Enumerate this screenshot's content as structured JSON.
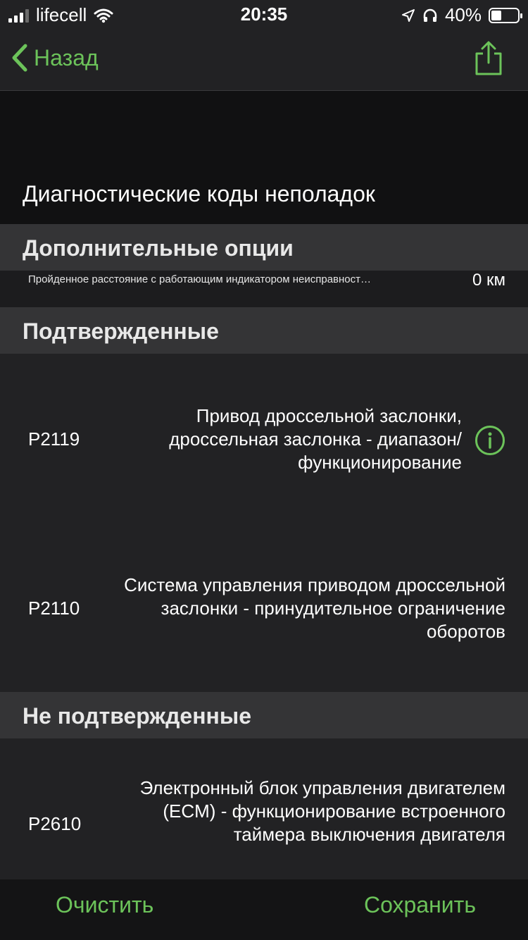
{
  "status_bar": {
    "carrier": "lifecell",
    "time": "20:35",
    "battery": "40%",
    "battery_level": 0.4
  },
  "nav": {
    "back_label": "Назад",
    "back_icon": "chevron-left-icon",
    "share_icon": "share-icon"
  },
  "page": {
    "title": "Диагностические коды неполадок"
  },
  "sections": {
    "options": {
      "title": "Дополнительные опции",
      "rows": [
        {
          "label": "Пройденное расстояние с работающим индикатором неисправност…",
          "value": "0 км"
        }
      ]
    },
    "confirmed": {
      "title": "Подтвержденные",
      "rows": [
        {
          "code": "P2119",
          "description": "Привод дроссельной заслонки, дроссельная заслонка - диапазон/ функционирование"
        },
        {
          "code": "P2110",
          "description": "Система управления приводом дроссельной заслонки - принудительное ограничение оборотов"
        }
      ]
    },
    "unconfirmed": {
      "title": "Не подтвержденные",
      "rows": [
        {
          "code": "P2610",
          "description": "Электронный блок управления двигателем (ECM) - функционирование встроенного таймера выключения двигателя"
        }
      ]
    }
  },
  "footer": {
    "clear_label": "Очистить",
    "save_label": "Сохранить"
  },
  "colors": {
    "accent": "#6cc35a",
    "background": "#1c1c1e",
    "section_header": "#343436"
  }
}
